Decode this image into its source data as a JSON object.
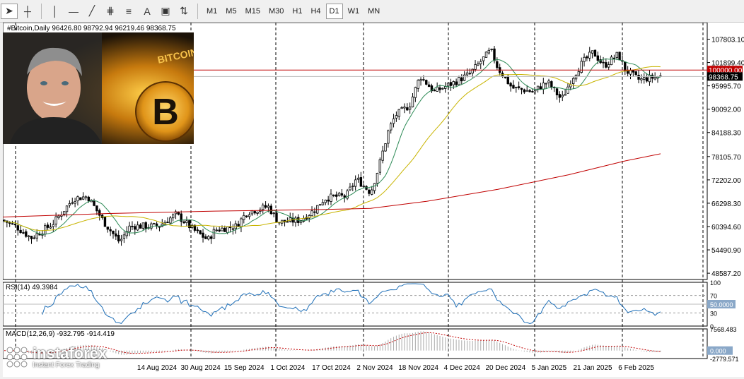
{
  "toolbar": {
    "timeframes": [
      "M1",
      "M5",
      "M15",
      "M30",
      "H1",
      "H4",
      "D1",
      "W1",
      "MN"
    ],
    "active_timeframe": "D1",
    "tools": [
      "cursor-icon",
      "crosshair-icon",
      "vertical-line-icon",
      "horizontal-line-icon",
      "trendline-icon",
      "fibonacci-icon",
      "channel-icon",
      "text-icon",
      "text-label-icon",
      "arrows-icon"
    ]
  },
  "chart_header": "#Bitcoin,Daily  96426.80 98792.94 96219.46 98368.75",
  "price_axis": {
    "ticks": [
      "107803.10",
      "101899.40",
      "95995.70",
      "90092.00",
      "84188.30",
      "78105.70",
      "72202.00",
      "66298.30",
      "60394.60",
      "54490.90",
      "48587.20"
    ],
    "tick_values": [
      107803.1,
      101899.4,
      95995.7,
      90092.0,
      84188.3,
      78105.7,
      72202.0,
      66298.3,
      60394.6,
      54490.9,
      48587.2
    ],
    "range": [
      47000,
      112000
    ],
    "level_label": "100000.00",
    "current_label": "98368.75"
  },
  "rsi": {
    "label": "RSI(14) 49.3984",
    "ticks": [
      "100",
      "70",
      "50.0000",
      "30",
      "0"
    ]
  },
  "macd": {
    "label": "MACD(12,26,9) -932.795 -914.419",
    "ticks": [
      "7568.483",
      "0.000",
      "-2779.571"
    ]
  },
  "time_axis": [
    "14 Aug 2024",
    "30 Aug 2024",
    "15 Sep 2024",
    "1 Oct 2024",
    "17 Oct 2024",
    "2 Nov 2024",
    "18 Nov 2024",
    "4 Dec 2024",
    "20 Dec 2024",
    "5 Jan 2025",
    "21 Jan 2025",
    "6 Feb 2025"
  ],
  "photo": {
    "coin_text": "BITCOIN",
    "coin_symbol": "B"
  },
  "watermark": {
    "brand": "instaforex",
    "tagline": "Instant Forex Trading"
  },
  "colors": {
    "bull": "#000000",
    "bear": "#000000",
    "ma_fast": "#2e8b57",
    "ma_mid": "#c8b400",
    "ma_slow": "#c00000",
    "level": "#c00000",
    "rsi": "#1e6fb8",
    "macd_hist": "#aaaaaa",
    "macd_signal": "#c00000"
  },
  "chart_data": {
    "type": "candlestick",
    "title": "#Bitcoin,Daily",
    "ohlc_last": {
      "open": 96426.8,
      "high": 98792.94,
      "low": 96219.46,
      "close": 98368.75
    },
    "ylim": [
      48587.2,
      107803.1
    ],
    "horizontal_level": 100000.0,
    "x": [
      "14 Aug 2024",
      "30 Aug 2024",
      "15 Sep 2024",
      "1 Oct 2024",
      "17 Oct 2024",
      "2 Nov 2024",
      "18 Nov 2024",
      "4 Dec 2024",
      "20 Dec 2024",
      "5 Jan 2025",
      "21 Jan 2025",
      "6 Feb 2025"
    ],
    "close_approx": [
      59000,
      59000,
      60500,
      60800,
      67500,
      69500,
      91000,
      98000,
      94000,
      98000,
      104000,
      97500
    ],
    "rsi_value": 49.3984,
    "macd_values": [
      -932.795,
      -914.419
    ]
  }
}
